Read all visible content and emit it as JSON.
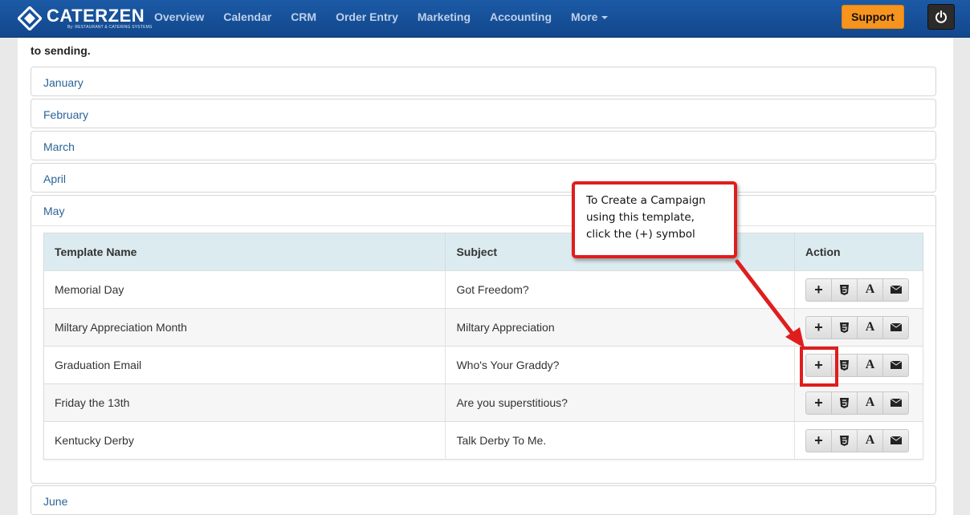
{
  "app": {
    "logo_name": "CATERZEN",
    "logo_sub": "By: RESTAURANT & CATERING SYSTEMS"
  },
  "nav": {
    "items": [
      "Overview",
      "Calendar",
      "CRM",
      "Order Entry",
      "Marketing",
      "Accounting",
      "More"
    ],
    "support_label": "Support"
  },
  "intro_text": "to sending.",
  "months_top": [
    "January",
    "February",
    "March",
    "April"
  ],
  "may": {
    "label": "May",
    "columns": [
      "Template Name",
      "Subject",
      "Action"
    ],
    "rows": [
      {
        "name": "Memorial Day",
        "subject": "Got Freedom?"
      },
      {
        "name": "Miltary Appreciation Month",
        "subject": "Miltary Appreciation"
      },
      {
        "name": "Graduation Email",
        "subject": "Who's Your Graddy?"
      },
      {
        "name": "Friday the 13th",
        "subject": "Are you superstitious?"
      },
      {
        "name": "Kentucky Derby",
        "subject": "Talk Derby To Me."
      }
    ]
  },
  "june_label": "June",
  "callout": {
    "line1": "To Create a Campaign",
    "line2": "using this template,",
    "line3": "click the (+) symbol"
  },
  "colors": {
    "navbar": "#1c5aa6",
    "support": "#f7941d",
    "callout_border": "#e01d1d",
    "link": "#2a6496"
  }
}
